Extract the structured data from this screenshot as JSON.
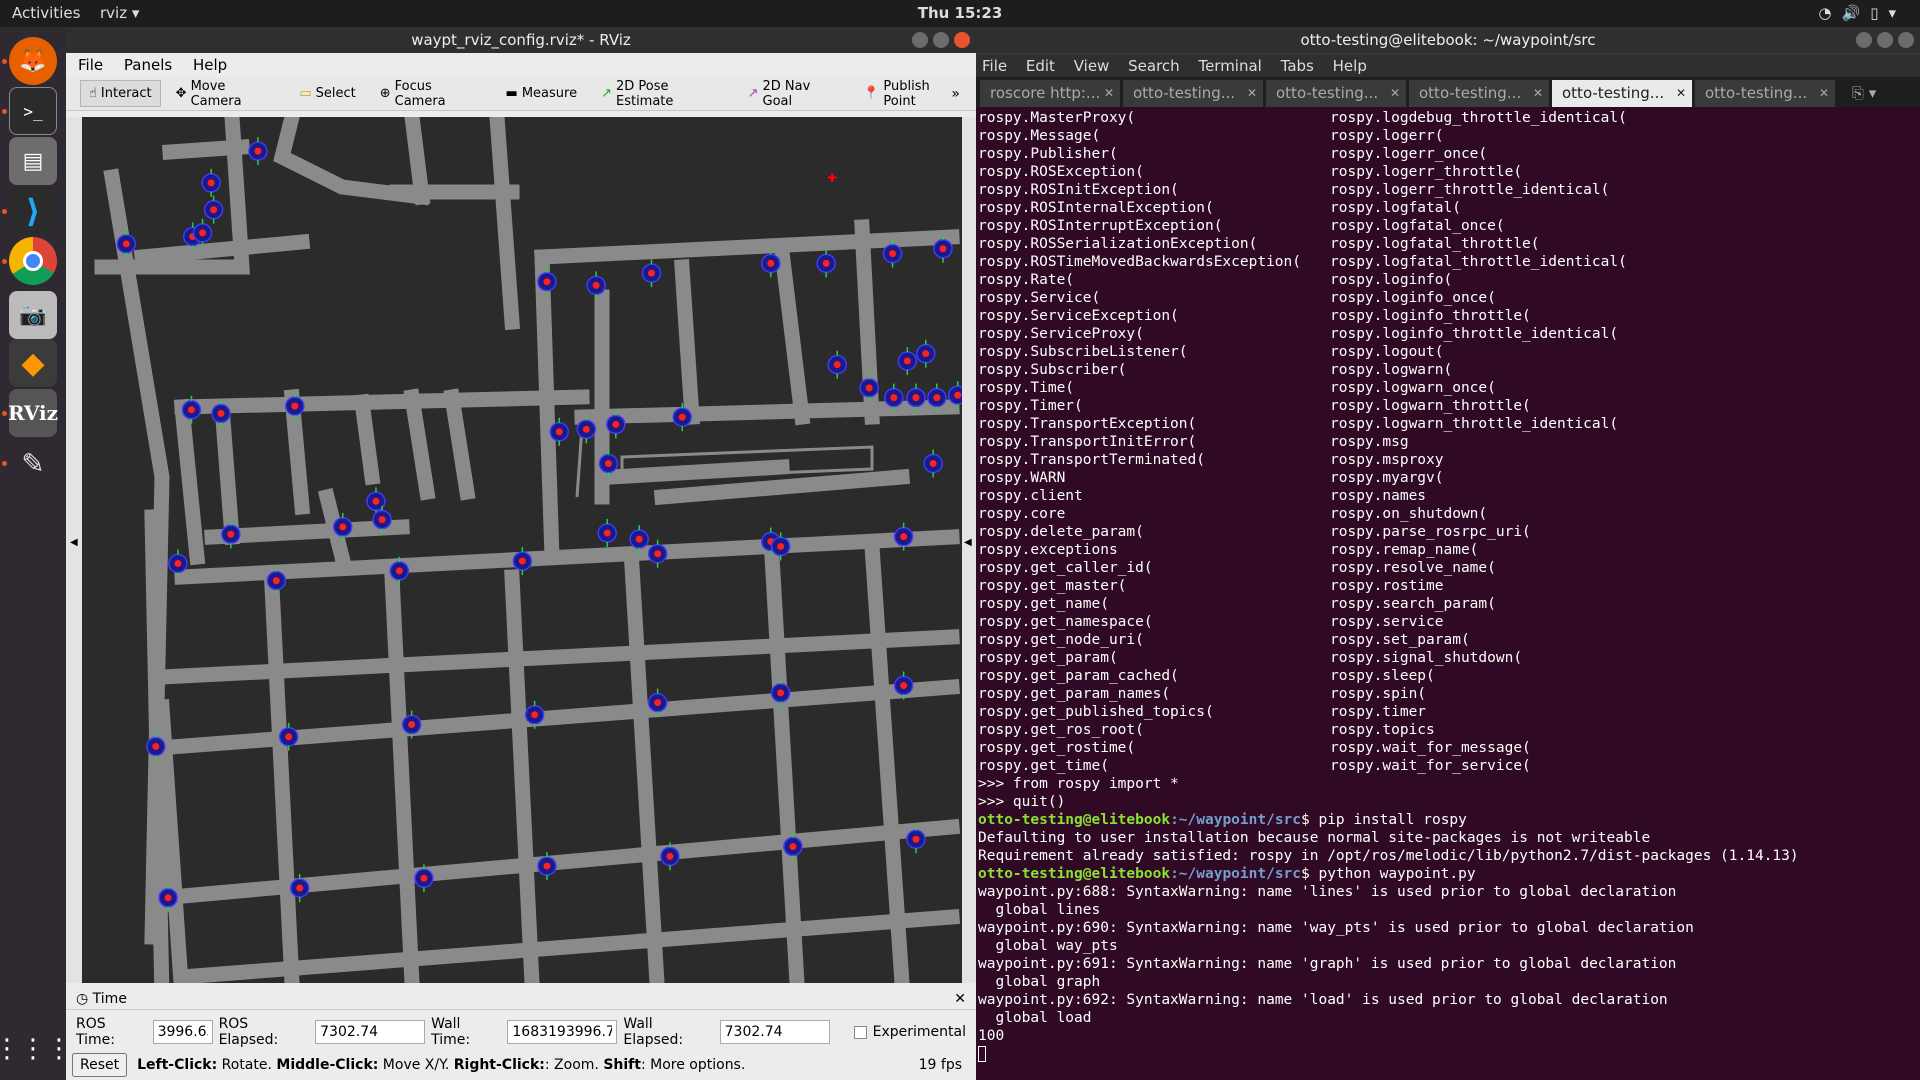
{
  "topbar": {
    "activities": "Activities",
    "app_name": "rviz",
    "clock": "Thu 15:23"
  },
  "dock": {
    "items": [
      "firefox-icon",
      "terminal-icon",
      "files-icon",
      "vscode-icon",
      "chrome-icon",
      "camera-icon",
      "sublime-icon",
      "rviz-icon",
      "editor-icon",
      "app-grid-icon"
    ]
  },
  "rviz": {
    "title": "waypt_rviz_config.rviz* - RViz",
    "menu": [
      "File",
      "Panels",
      "Help"
    ],
    "tools": [
      {
        "label": "Interact",
        "icon": "☝"
      },
      {
        "label": "Move Camera",
        "icon": "✥"
      },
      {
        "label": "Select",
        "icon": "▭"
      },
      {
        "label": "Focus Camera",
        "icon": "⊕"
      },
      {
        "label": "Measure",
        "icon": "▬"
      },
      {
        "label": "2D Pose Estimate",
        "icon": "↗"
      },
      {
        "label": "2D Nav Goal",
        "icon": "↗"
      },
      {
        "label": "Publish Point",
        "icon": "📍"
      }
    ],
    "more_tools": "»",
    "time_panel": {
      "title": "Time",
      "ros_time_label": "ROS Time:",
      "ros_time_value": "3996.65",
      "ros_elapsed_label": "ROS Elapsed:",
      "ros_elapsed_value": "7302.74",
      "wall_time_label": "Wall Time:",
      "wall_time_value": "1683193996.70",
      "wall_elapsed_label": "Wall Elapsed:",
      "wall_elapsed_value": "7302.74",
      "experimental_label": "Experimental",
      "reset_label": "Reset",
      "hint_left_click": "Left-Click:",
      "hint_rotate": " Rotate. ",
      "hint_middle_click": "Middle-Click:",
      "hint_move": " Move X/Y. ",
      "hint_right_click": "Right-Click:",
      "hint_zoom": ": Zoom. ",
      "hint_shift": "Shift",
      "hint_more": ": More options.",
      "fps": "19 fps"
    }
  },
  "terminal": {
    "title": "otto-testing@elitebook: ~/waypoint/src",
    "menu": [
      "File",
      "Edit",
      "View",
      "Search",
      "Terminal",
      "Tabs",
      "Help"
    ],
    "tabs": [
      "roscore http:...",
      "otto-testing...",
      "otto-testing...",
      "otto-testing...",
      "otto-testing...",
      "otto-testing..."
    ],
    "active_tab": 4,
    "completions_left": [
      "rospy.MasterProxy(",
      "rospy.Message(",
      "rospy.Publisher(",
      "rospy.ROSException(",
      "rospy.ROSInitException(",
      "rospy.ROSInternalException(",
      "rospy.ROSInterruptException(",
      "rospy.ROSSerializationException(",
      "rospy.ROSTimeMovedBackwardsException(",
      "rospy.Rate(",
      "rospy.Service(",
      "rospy.ServiceException(",
      "rospy.ServiceProxy(",
      "rospy.SubscribeListener(",
      "rospy.Subscriber(",
      "rospy.Time(",
      "rospy.Timer(",
      "rospy.TransportException(",
      "rospy.TransportInitError(",
      "rospy.TransportTerminated(",
      "rospy.WARN",
      "rospy.client",
      "rospy.core",
      "rospy.delete_param(",
      "rospy.exceptions",
      "rospy.get_caller_id(",
      "rospy.get_master(",
      "rospy.get_name(",
      "rospy.get_namespace(",
      "rospy.get_node_uri(",
      "rospy.get_param(",
      "rospy.get_param_cached(",
      "rospy.get_param_names(",
      "rospy.get_published_topics(",
      "rospy.get_ros_root(",
      "rospy.get_rostime(",
      "rospy.get_time("
    ],
    "completions_right": [
      "rospy.logdebug_throttle_identical(",
      "rospy.logerr(",
      "rospy.logerr_once(",
      "rospy.logerr_throttle(",
      "rospy.logerr_throttle_identical(",
      "rospy.logfatal(",
      "rospy.logfatal_once(",
      "rospy.logfatal_throttle(",
      "rospy.logfatal_throttle_identical(",
      "rospy.loginfo(",
      "rospy.loginfo_once(",
      "rospy.loginfo_throttle(",
      "rospy.loginfo_throttle_identical(",
      "rospy.logout(",
      "rospy.logwarn(",
      "rospy.logwarn_once(",
      "rospy.logwarn_throttle(",
      "rospy.logwarn_throttle_identical(",
      "rospy.msg",
      "rospy.msproxy",
      "rospy.myargv(",
      "rospy.names",
      "rospy.on_shutdown(",
      "rospy.parse_rosrpc_uri(",
      "rospy.remap_name(",
      "rospy.resolve_name(",
      "rospy.rostime",
      "rospy.search_param(",
      "rospy.service",
      "rospy.set_param(",
      "rospy.signal_shutdown(",
      "rospy.sleep(",
      "rospy.spin(",
      "rospy.timer",
      "rospy.topics",
      "rospy.wait_for_message(",
      "rospy.wait_for_service("
    ],
    "line_import": ">>> from rospy import *",
    "line_quit": ">>> quit()",
    "prompt_user": "otto-testing@elitebook",
    "prompt_path": ":~/waypoint/src",
    "cmd1": "$ pip install rospy",
    "out1": "Defaulting to user installation because normal site-packages is not writeable",
    "out2": "Requirement already satisfied: rospy in /opt/ros/melodic/lib/python2.7/dist-packages (1.14.13)",
    "cmd2": "$ python waypoint.py",
    "warn1": "waypoint.py:688: SyntaxWarning: name 'lines' is used prior to global declaration",
    "warn1b": "  global lines",
    "warn2": "waypoint.py:690: SyntaxWarning: name 'way_pts' is used prior to global declaration",
    "warn2b": "  global way_pts",
    "warn3": "waypoint.py:691: SyntaxWarning: name 'graph' is used prior to global declaration",
    "warn3b": "  global graph",
    "warn4": "waypoint.py:692: SyntaxWarning: name 'load' is used prior to global declaration",
    "warn4b": "  global load",
    "out_last": "100"
  }
}
